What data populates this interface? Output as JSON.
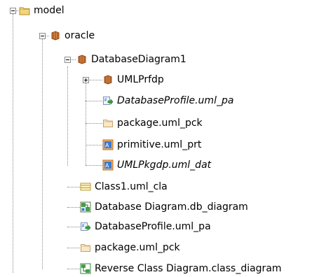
{
  "tree": {
    "nodes": [
      {
        "id": "model",
        "label": "model",
        "icon": "folder-icon",
        "italic": false,
        "toggle": "collapse"
      },
      {
        "id": "oracle",
        "label": "oracle",
        "icon": "package-icon",
        "italic": false,
        "toggle": "collapse"
      },
      {
        "id": "databasediagram1",
        "label": "DatabaseDiagram1",
        "icon": "package-icon",
        "italic": false,
        "toggle": "collapse"
      },
      {
        "id": "umlprfdp",
        "label": "UMLPrfdp",
        "icon": "package-icon",
        "italic": false,
        "toggle": "expand"
      },
      {
        "id": "databaseprofile-pa-inner",
        "label": "DatabaseProfile.uml_pa",
        "icon": "profile-application-icon",
        "italic": true,
        "toggle": null
      },
      {
        "id": "package-pck-inner",
        "label": "package.uml_pck",
        "icon": "package-file-icon",
        "italic": false,
        "toggle": null
      },
      {
        "id": "primitive-prt",
        "label": "primitive.uml_prt",
        "icon": "primitive-type-icon",
        "italic": false,
        "toggle": null
      },
      {
        "id": "umlpkgdp-dat",
        "label": "UMLPkgdp.uml_dat",
        "icon": "data-type-icon",
        "italic": true,
        "toggle": null
      },
      {
        "id": "class1-cla",
        "label": "Class1.uml_cla",
        "icon": "class-icon",
        "italic": false,
        "toggle": null
      },
      {
        "id": "database-diagram",
        "label": "Database Diagram.db_diagram",
        "icon": "database-diagram-icon",
        "italic": false,
        "toggle": null
      },
      {
        "id": "databaseprofile-pa-outer",
        "label": "DatabaseProfile.uml_pa",
        "icon": "profile-application-icon",
        "italic": false,
        "toggle": null
      },
      {
        "id": "package-pck-outer",
        "label": "package.uml_pck",
        "icon": "package-file-icon",
        "italic": false,
        "toggle": null
      },
      {
        "id": "reverse-class-diagram",
        "label": "Reverse Class Diagram.class_diagram",
        "icon": "class-diagram-icon",
        "italic": false,
        "toggle": null
      }
    ]
  },
  "colors": {
    "guide": "#8a8a8a",
    "folder": "#f3d67a",
    "package": "#c8692a",
    "accent_green": "#2fa33a",
    "accent_blue": "#3a7ad0"
  }
}
